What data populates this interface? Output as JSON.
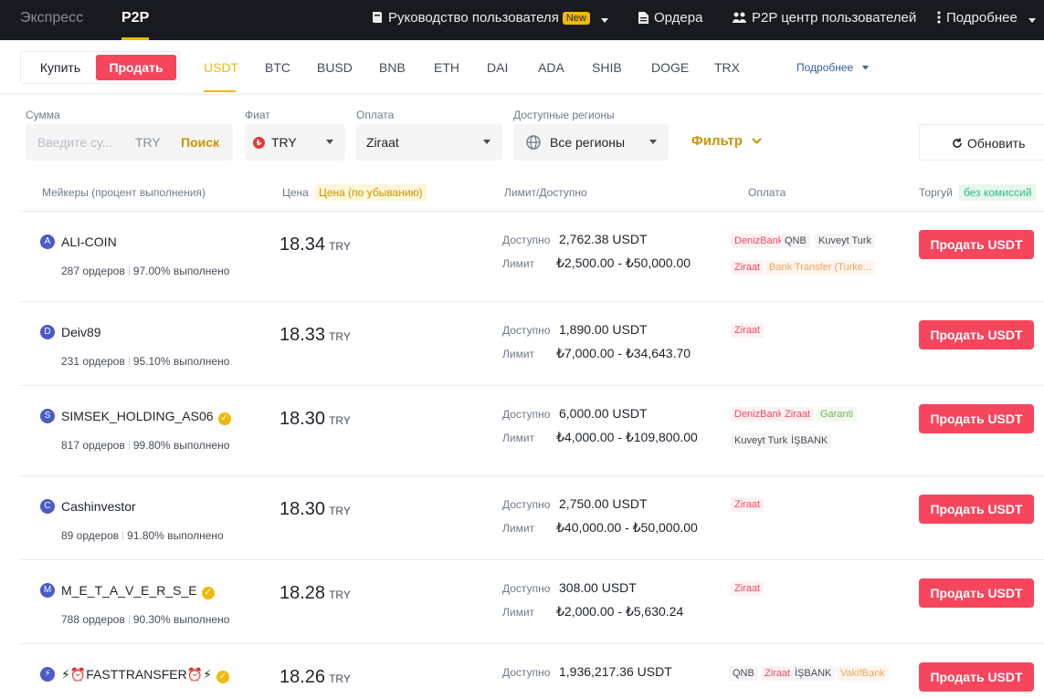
{
  "topbar": {
    "express": "Экспресс",
    "p2p": "P2P",
    "guide": "Руководство пользователя",
    "new_badge": "New",
    "orders": "Ордера",
    "p2p_center": "P2P центр пользователей",
    "more": "Подробнее"
  },
  "subbar": {
    "buy": "Купить",
    "sell": "Продать",
    "assets": [
      "USDT",
      "BTC",
      "BUSD",
      "BNB",
      "ETH",
      "DAI",
      "ADA",
      "SHIB",
      "DOGE",
      "TRX"
    ],
    "active_asset": "USDT",
    "more": "Подробнее"
  },
  "filters": {
    "amount_label": "Сумма",
    "amount_placeholder": "Введите су...",
    "amount_currency": "TRY",
    "search": "Поиск",
    "fiat_label": "Фиат",
    "fiat_value": "TRY",
    "payment_label": "Оплата",
    "payment_value": "Ziraat",
    "regions_label": "Доступные регионы",
    "regions_value": "Все регионы",
    "filter": "Фильтр",
    "refresh": "Обновить"
  },
  "table": {
    "headers": {
      "makers": "Мейкеры (процент выполнения)",
      "price": "Цена",
      "price_sort": "Цена (по убыванию)",
      "limit": "Лимит/Доступно",
      "payment": "Оплата",
      "trade": "Торгуй",
      "no_fee": "без комиссий"
    },
    "available_label": "Доступно",
    "limit_label": "Лимит",
    "price_currency": "TRY",
    "sell_button": "Продать USDT",
    "rows": [
      {
        "initial": "A",
        "name": "ALI-COIN",
        "verified": false,
        "orders": "287 ордеров",
        "completion": "97.00% выполнено",
        "price": "18.34",
        "available": "2,762.38 USDT",
        "limit": "₺2,500.00 - ₺50,000.00",
        "payments": [
          {
            "name": "DenizBank",
            "color": "red"
          },
          {
            "name": "QNB",
            "color": "gray"
          },
          {
            "name": "Kuveyt Turk",
            "color": "gray"
          },
          {
            "name": "Ziraat",
            "color": "red"
          },
          {
            "name": "Bank Transfer (Turke...",
            "color": "orange"
          }
        ]
      },
      {
        "initial": "D",
        "name": "Deiv89",
        "verified": false,
        "orders": "231 ордеров",
        "completion": "95.10% выполнено",
        "price": "18.33",
        "available": "1,890.00 USDT",
        "limit": "₺7,000.00 - ₺34,643.70",
        "payments": [
          {
            "name": "Ziraat",
            "color": "red"
          }
        ]
      },
      {
        "initial": "S",
        "name": "SIMSEK_HOLDING_AS06",
        "verified": true,
        "orders": "817 ордеров",
        "completion": "99.80% выполнено",
        "price": "18.30",
        "available": "6,000.00 USDT",
        "limit": "₺4,000.00 - ₺109,800.00",
        "payments": [
          {
            "name": "DenizBank",
            "color": "red"
          },
          {
            "name": "Ziraat",
            "color": "red"
          },
          {
            "name": "Garanti",
            "color": "green"
          },
          {
            "name": "Kuveyt Turk",
            "color": "gray"
          },
          {
            "name": "İŞBANK",
            "color": "gray"
          }
        ]
      },
      {
        "initial": "C",
        "name": "Cashinvestor",
        "verified": false,
        "orders": "89 ордеров",
        "completion": "91.80% выполнено",
        "price": "18.30",
        "available": "2,750.00 USDT",
        "limit": "₺40,000.00 - ₺50,000.00",
        "payments": [
          {
            "name": "Ziraat",
            "color": "red"
          }
        ]
      },
      {
        "initial": "M",
        "name": "M_E_T_A_V_E_R_S_E",
        "verified": true,
        "orders": "788 ордеров",
        "completion": "90.30% выполнено",
        "price": "18.28",
        "available": "308.00 USDT",
        "limit": "₺2,000.00 - ₺5,630.24",
        "payments": [
          {
            "name": "Ziraat",
            "color": "red"
          }
        ]
      },
      {
        "initial": "⚡",
        "name": "⚡⏰FASTTRANSFER⏰⚡",
        "verified": true,
        "orders": "",
        "completion": "",
        "price": "18.26",
        "available": "1,936,217.36 USDT",
        "limit": "",
        "payments": [
          {
            "name": "QNB",
            "color": "gray"
          },
          {
            "name": "Ziraat",
            "color": "red"
          },
          {
            "name": "İŞBANK",
            "color": "gray"
          },
          {
            "name": "VakifBank",
            "color": "orange"
          }
        ]
      }
    ]
  }
}
